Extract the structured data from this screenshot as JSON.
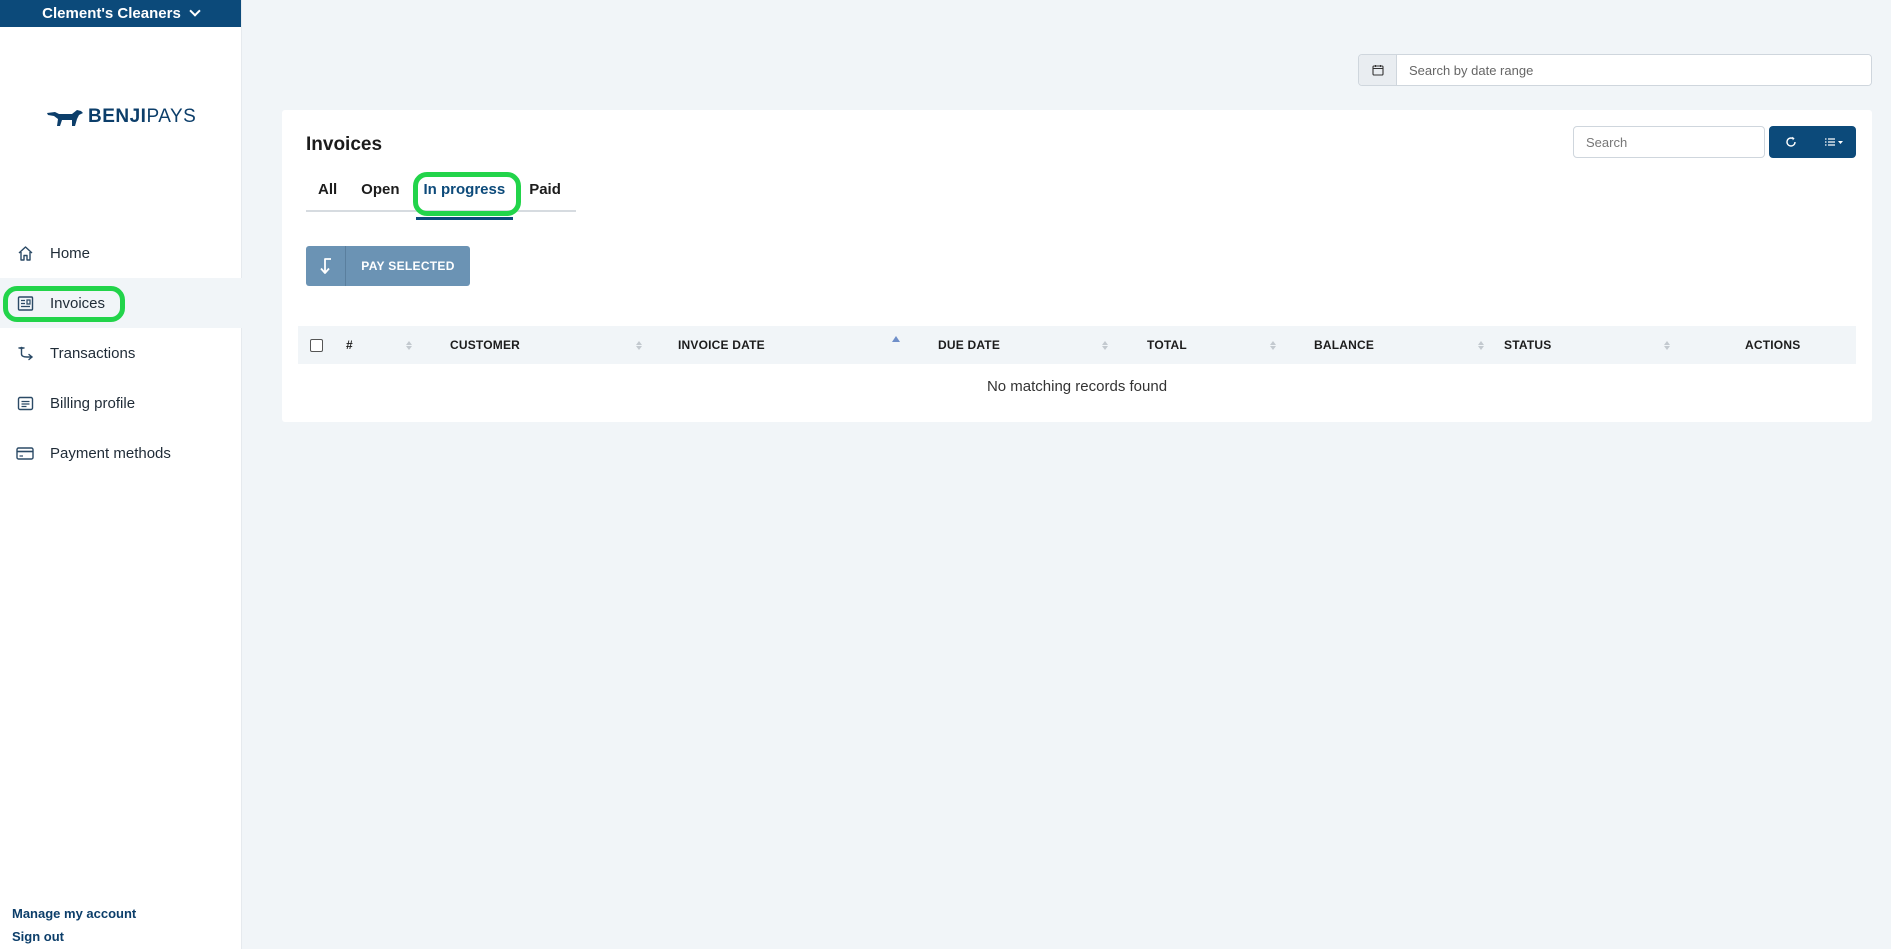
{
  "sidebar": {
    "company": "Clement's Cleaners",
    "logo": {
      "bold": "BENJI",
      "light": "PAYS"
    },
    "items": [
      {
        "label": "Home",
        "icon": "home-icon"
      },
      {
        "label": "Invoices",
        "icon": "invoice-icon"
      },
      {
        "label": "Transactions",
        "icon": "transactions-icon"
      },
      {
        "label": "Billing profile",
        "icon": "billing-profile-icon"
      },
      {
        "label": "Payment methods",
        "icon": "credit-card-icon"
      }
    ],
    "active_item": "Invoices",
    "footer": {
      "manage": "Manage my account",
      "signout": "Sign out"
    }
  },
  "date_range": {
    "placeholder": "Search by date range"
  },
  "panel": {
    "title": "Invoices",
    "tabs": [
      "All",
      "Open",
      "In progress",
      "Paid"
    ],
    "active_tab": "In progress",
    "search_placeholder": "Search",
    "pay_selected": "PAY SELECTED"
  },
  "table": {
    "columns": [
      "#",
      "CUSTOMER",
      "INVOICE DATE",
      "DUE DATE",
      "TOTAL",
      "BALANCE",
      "STATUS",
      "ACTIONS"
    ],
    "sorted_column": "INVOICE DATE",
    "sort_direction": "ascending",
    "empty_message": "No matching records found"
  },
  "colors": {
    "brand": "#0c4a7a",
    "highlight": "#22d44a",
    "pay_button": "#6b93b4"
  }
}
